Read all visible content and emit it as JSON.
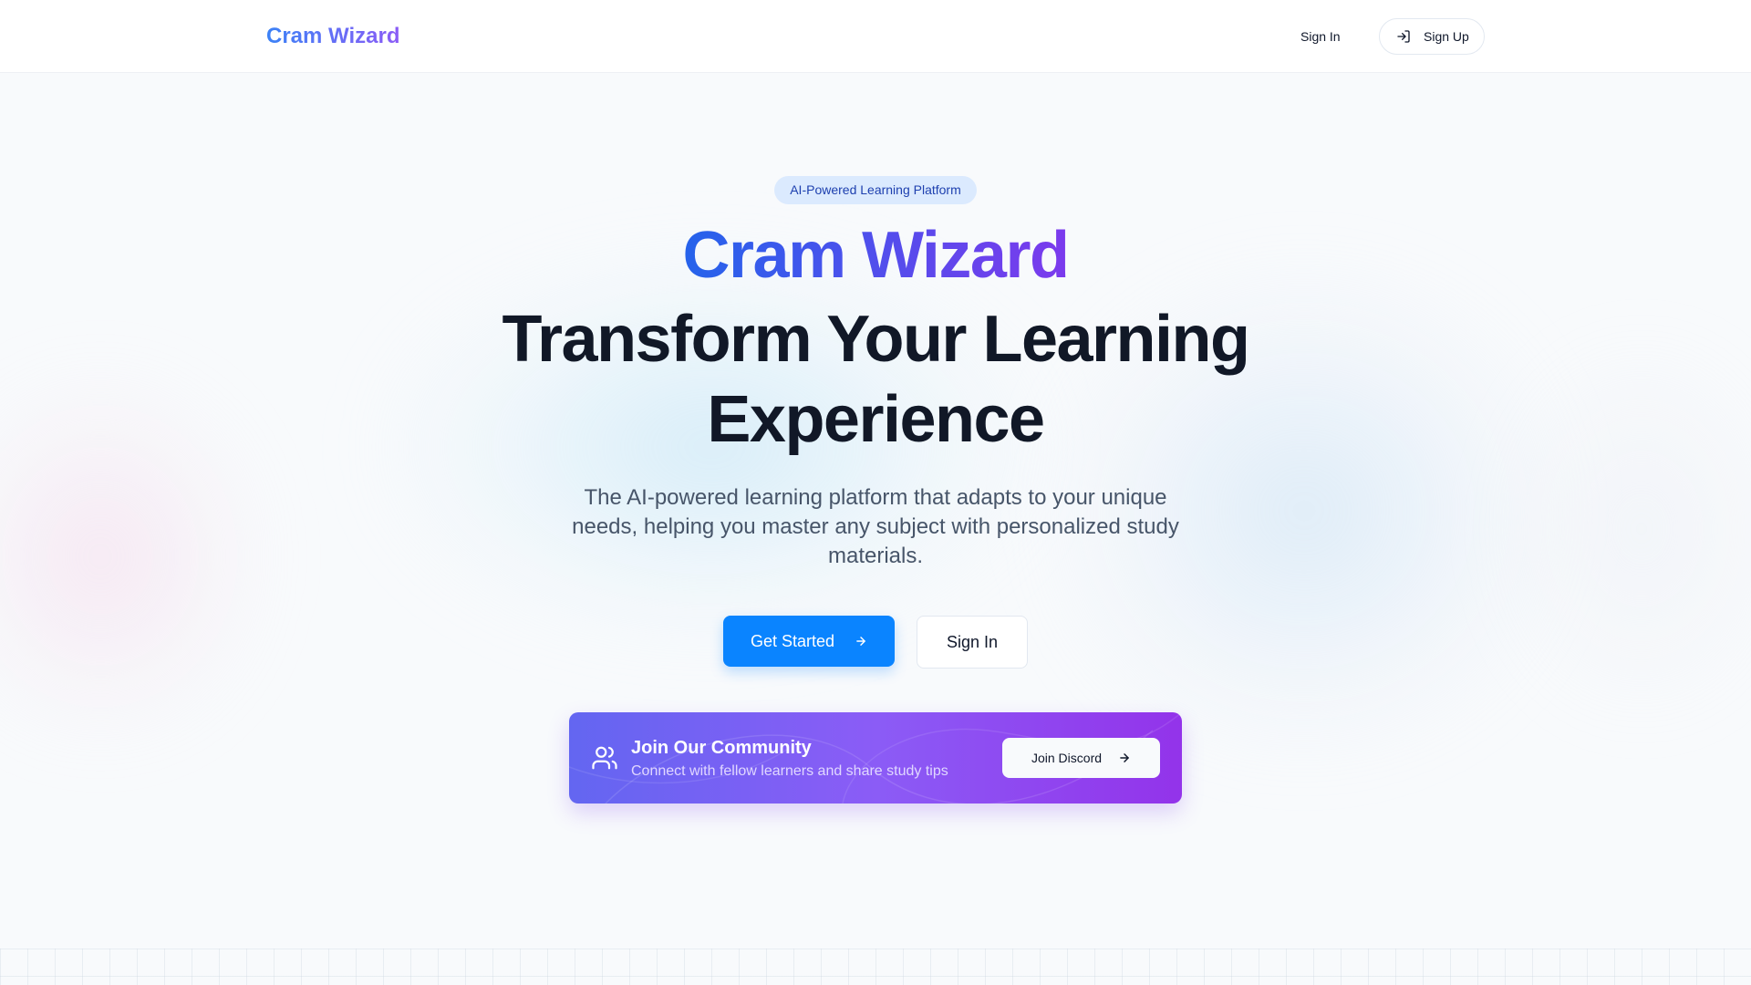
{
  "header": {
    "logo": "Cram Wizard",
    "sign_in": "Sign In",
    "sign_up": "Sign Up"
  },
  "hero": {
    "badge": "AI-Powered Learning Platform",
    "brand": "Cram Wizard",
    "headline_line1": "Transform Your Learning",
    "headline_line2": "Experience",
    "description": "The AI-powered learning platform that adapts to your unique needs, helping you master any subject with personalized study materials.",
    "primary_button": "Get Started",
    "secondary_button": "Sign In"
  },
  "community": {
    "title": "Join Our Community",
    "text": "Connect with fellow learners and share study tips",
    "button": "Join Discord"
  },
  "icons": {
    "sign_up": "log-in-icon",
    "get_started": "arrow-right-icon",
    "community": "users-icon",
    "join_discord": "arrow-right-icon"
  },
  "colors": {
    "primary": "#0a84ff",
    "brand_gradient_start": "#2563eb",
    "brand_gradient_end": "#7c3aed",
    "badge_bg": "#dbeafe",
    "badge_text": "#1e40af",
    "community_start": "#6366f1",
    "community_end": "#9333ea"
  }
}
